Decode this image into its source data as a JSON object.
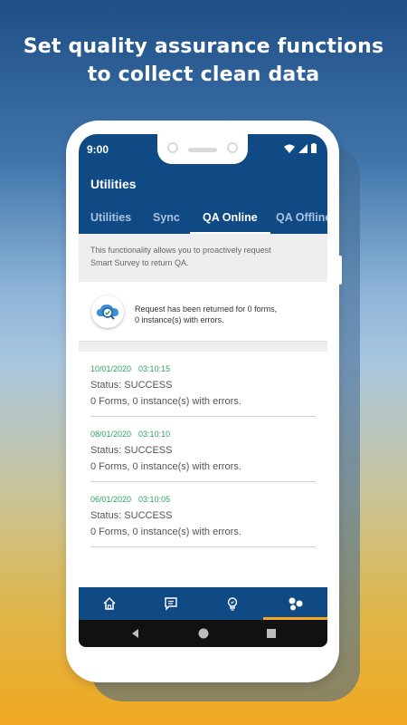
{
  "headline": {
    "line1": "Set quality assurance functions",
    "line2": "to collect clean data"
  },
  "status_bar": {
    "time": "9:00"
  },
  "app_bar": {
    "title": "Utilities"
  },
  "tabs": [
    {
      "label": "Utilities",
      "active": false
    },
    {
      "label": "Sync",
      "active": false
    },
    {
      "label": "QA Online",
      "active": true
    },
    {
      "label": "QA Offline",
      "active": false
    }
  ],
  "info": {
    "text_line1": "This functionality allows you to proactively request",
    "text_line2": "Smart Survey to return QA."
  },
  "request": {
    "line1": "Request has been returned for 0  forms,",
    "line2": "0 instance(s) with errors."
  },
  "history": [
    {
      "date": "10/01/2020",
      "time": "03:10:15",
      "status": "Status: SUCCESS",
      "detail": "0 Forms, 0 instance(s) with errors."
    },
    {
      "date": "08/01/2020",
      "time": "03:10:10",
      "status": "Status: SUCCESS",
      "detail": "0 Forms, 0 instance(s) with errors."
    },
    {
      "date": "06/01/2020",
      "time": "03:10:05",
      "status": "Status: SUCCESS",
      "detail": "0 Forms, 0 instance(s) with errors."
    }
  ],
  "bottom_nav": [
    {
      "icon": "home-icon",
      "active": false
    },
    {
      "icon": "message-icon",
      "active": false
    },
    {
      "icon": "lightbulb-icon",
      "active": false
    },
    {
      "icon": "utilities-icon",
      "active": true
    }
  ],
  "colors": {
    "primary": "#0f4a85",
    "accent": "#f5a623",
    "timestamp": "#2e9e5b"
  }
}
